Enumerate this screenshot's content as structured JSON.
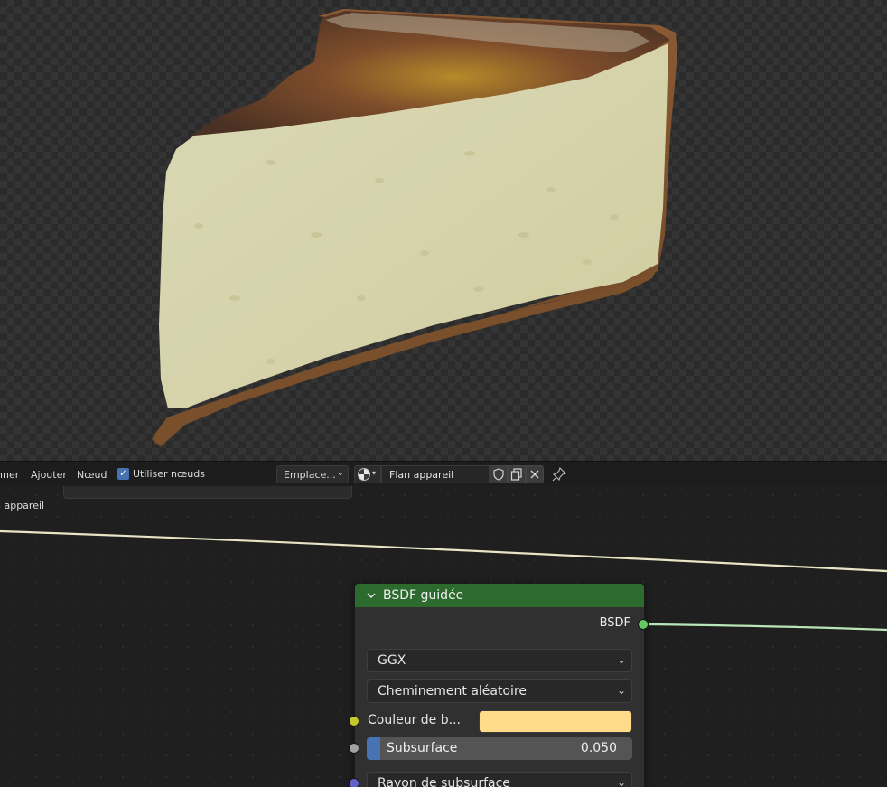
{
  "header": {
    "menu_select": "nner",
    "menu_add": "Ajouter",
    "menu_node": "Nœud",
    "use_nodes_label": "Utiliser nœuds",
    "use_nodes_checked": true,
    "slot_label": "Emplace...",
    "material_name": "Flan appareil"
  },
  "breadcrumb": "n appareil",
  "node": {
    "title": "BSDF guidée",
    "header_color": "#2d6a2e",
    "output_label": "BSDF",
    "output_socket_color": "#63c763",
    "distribution": "GGX",
    "subsurface_method": "Cheminement aléatoire",
    "base_color_label": "Couleur de b...",
    "base_color_value": "#ffdb8a",
    "base_color_socket_color": "#c7c729",
    "subsurface_label": "Subsurface",
    "subsurface_value": "0.050",
    "subsurface_fraction": 0.05,
    "subsurface_socket_color": "#a1a1a1",
    "subsurface_radius_label": "Rayon de subsurface",
    "subsurface_radius_socket_color": "#6363c7"
  },
  "icons": {
    "viewport_background": "checkerboard-transparency",
    "material_browse": "material-sphere-icon",
    "fake_user": "shield-icon",
    "duplicate": "duplicate-icon",
    "unlink": "close-icon",
    "pin": "pin-icon",
    "collapse": "chevron-down-icon"
  }
}
